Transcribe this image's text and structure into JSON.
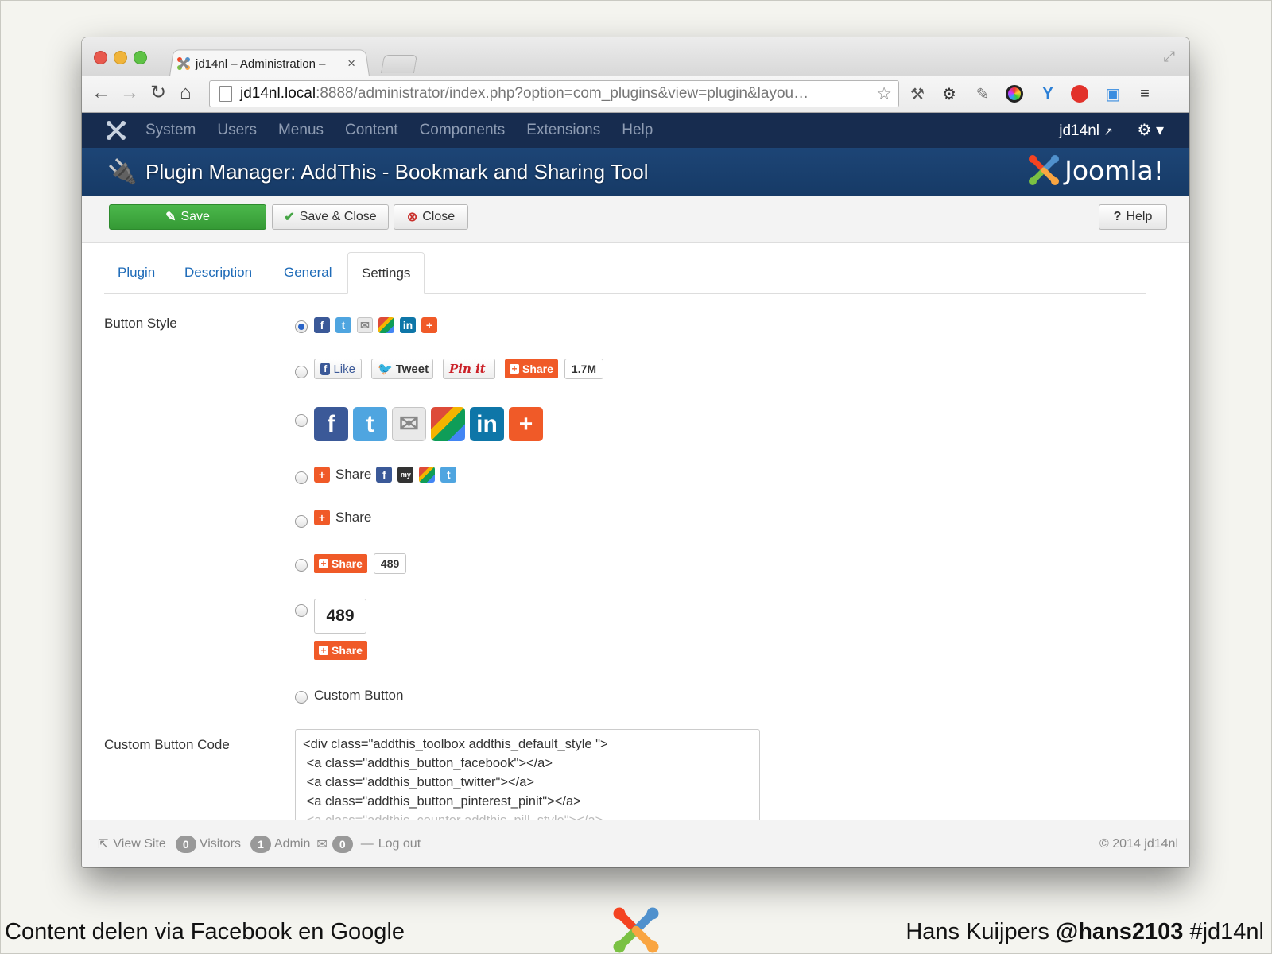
{
  "browser": {
    "tab_title": "jd14nl – Administration – ",
    "tab_close": "×",
    "url_host": "jd14nl.local",
    "url_rest": ":8888/administrator/index.php?option=com_plugins&view=plugin&layou…"
  },
  "admin_nav": {
    "menu": [
      "System",
      "Users",
      "Menus",
      "Content",
      "Components",
      "Extensions",
      "Help"
    ],
    "user": "jd14nl"
  },
  "header": {
    "title": "Plugin Manager: AddThis - Bookmark and Sharing Tool",
    "brand": "Joomla!"
  },
  "toolbar": {
    "save": "Save",
    "save_close": "Save & Close",
    "close": "Close",
    "help": "Help"
  },
  "tabs": [
    "Plugin",
    "Description",
    "General",
    "Settings"
  ],
  "active_tab": "Settings",
  "settings": {
    "button_style_label": "Button Style",
    "selected_style_index": 0,
    "style2": {
      "like": "Like",
      "tweet": "Tweet",
      "pinit": "Pin it",
      "share": "Share",
      "count": "1.7M"
    },
    "style4_share": "Share",
    "style5_share": "Share",
    "style6": {
      "share": "Share",
      "count": "489"
    },
    "style7": {
      "count": "489",
      "share": "Share"
    },
    "custom_button_label": "Custom Button",
    "custom_code_label": "Custom Button Code",
    "custom_code_lines": [
      "<div class=\"addthis_toolbox addthis_default_style \">",
      " <a class=\"addthis_button_facebook\"></a>",
      " <a class=\"addthis_button_twitter\"></a>",
      " <a class=\"addthis_button_pinterest_pinit\"></a>",
      " <a class=\"addthis_counter addthis_pill_style\"></a>"
    ]
  },
  "status": {
    "view_site": "View Site",
    "visitors_count": "0",
    "visitors": "Visitors",
    "admin_count": "1",
    "admin": "Admin",
    "messages_count": "0",
    "logout": "Log out",
    "copyright": "© 2014 jd14nl"
  },
  "slide_footer": {
    "left": "Content delen via Facebook en Google",
    "right_name": "Hans Kuijpers ",
    "right_handle": "@hans2103",
    "right_tag": " #jd14nl"
  },
  "colors": {
    "nav_bg": "#172c4f",
    "header_bg": "#1d4576",
    "save_green": "#3aa53a",
    "link_blue": "#1e6bb8",
    "addthis_orange": "#f05a28"
  }
}
